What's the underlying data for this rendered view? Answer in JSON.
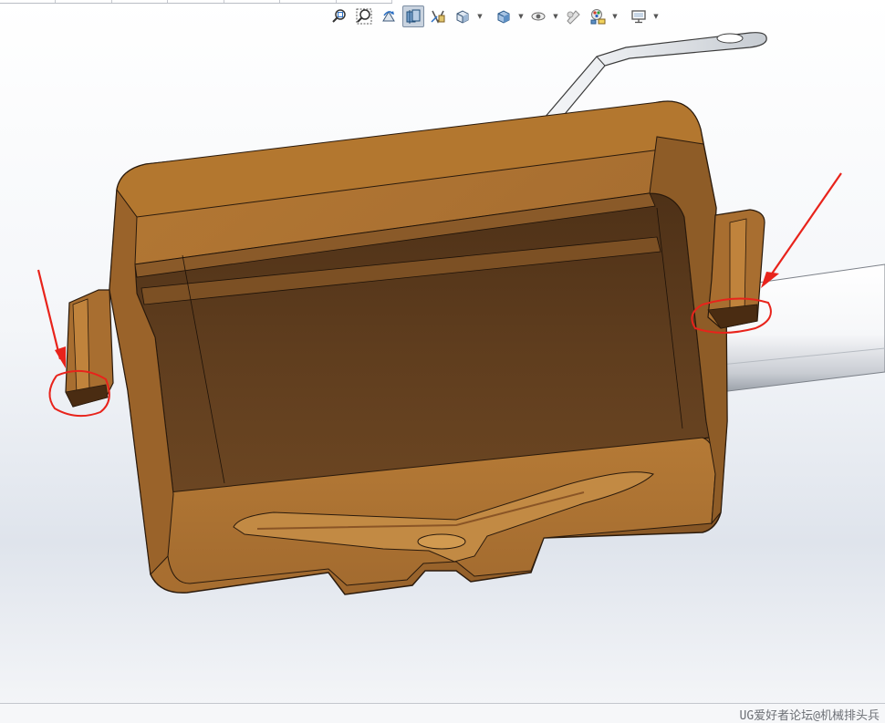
{
  "toolbar": {
    "items": [
      {
        "icon": "zoom-to-fit-icon"
      },
      {
        "icon": "zoom-to-area-icon"
      },
      {
        "icon": "previous-view-icon"
      },
      {
        "icon": "section-view-icon",
        "active": true
      },
      {
        "icon": "view-orientation-icon"
      },
      {
        "icon": "display-style-icon"
      },
      {
        "icon": "hide-show-items-icon"
      },
      {
        "icon": "edit-appearance-icon"
      },
      {
        "icon": "apply-scene-icon"
      },
      {
        "icon": "view-settings-icon"
      }
    ]
  },
  "annotations": {
    "markup_color": "#e8231b"
  },
  "part": {
    "body_color": "#a66d30",
    "inner_color": "#5b3a1c",
    "shaft_color": "#ffffff"
  },
  "status": {
    "watermark": "UG爱好者论坛@机械排头兵"
  }
}
